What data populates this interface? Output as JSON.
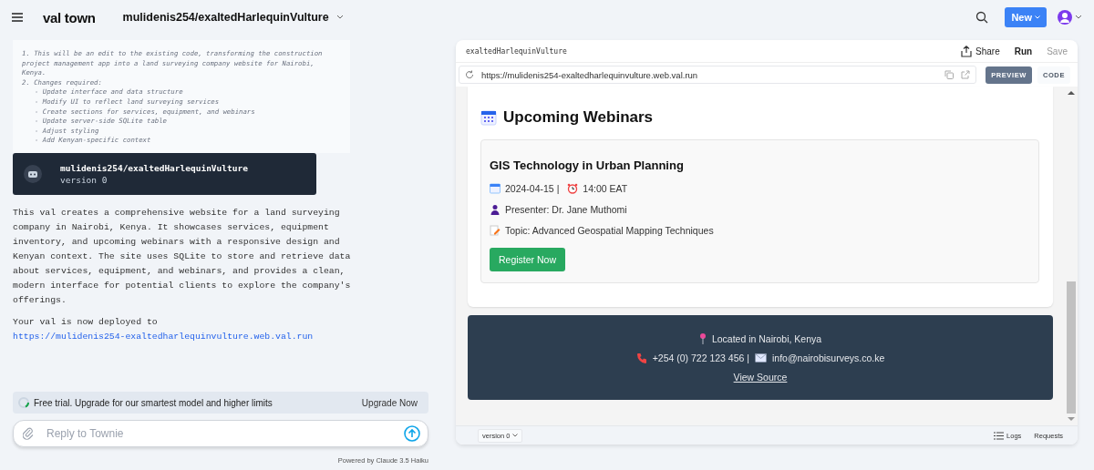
{
  "topbar": {
    "brand": "val town",
    "project": "mulidenis254/exaltedHarlequinVulture",
    "new_button": "New"
  },
  "chat": {
    "plan": [
      {
        "text": "1. This will be an edit to the existing code, transforming the construction project management app into a land surveying company website for Nairobi, Kenya."
      },
      {
        "text": "2. Changes required:",
        "children": [
          {
            "text": "- Update interface and data structure"
          },
          {
            "text": "- Modify UI to reflect land surveying services"
          },
          {
            "text": "- Create sections for services, equipment, and webinars"
          },
          {
            "text": "- Update server-side SQLite table"
          },
          {
            "text": "- Adjust styling"
          },
          {
            "text": "- Add Kenyan-specific context"
          }
        ]
      }
    ],
    "val_card": {
      "name": "mulidenis254/exaltedHarlequinVulture",
      "version": "version 0"
    },
    "description": "This val creates a comprehensive website for a land surveying company in Nairobi, Kenya. It showcases services, equipment inventory, and upcoming webinars with a responsive design and Kenyan context. The site uses SQLite to store and retrieve data about services, equipment, and webinars, and provides a clean, modern interface for potential clients to explore the company's offerings.",
    "deployed_text": "Your val is now deployed to",
    "deployed_link": "https://mulidenis254-exaltedharlequinvulture.web.val.run",
    "trial": {
      "text": "Free trial. Upgrade for our smartest model and higher limits",
      "action": "Upgrade Now"
    },
    "reply": {
      "placeholder": "Reply to Townie"
    },
    "powered_by": "Powered by Claude 3.5 Haiku"
  },
  "preview": {
    "title": "exaltedHarlequinVulture",
    "actions": [
      "Share",
      "Run",
      "Save"
    ],
    "url": "https://mulidenis254-exaltedharlequinvulture.web.val.run",
    "tabs": [
      {
        "label": "PREVIEW",
        "selected": true
      },
      {
        "label": "CODE",
        "selected": false
      }
    ],
    "section_title": "Upcoming Webinars",
    "webinar": {
      "title": "GIS Technology in Urban Planning",
      "date": "2024-04-15 |",
      "time": "14:00 EAT",
      "presenter": "Presenter: Dr. Jane Muthomi",
      "topic": "Topic: Advanced Geospatial Mapping Techniques",
      "button": "Register Now"
    },
    "footer": {
      "location": "Located in Nairobi, Kenya",
      "phone": "+254 (0) 722 123 456 |",
      "email": "info@nairobisurveys.co.ke",
      "link": "View Source"
    },
    "version": "version 0",
    "bottom_actions": [
      "Logs",
      "Requests"
    ]
  }
}
